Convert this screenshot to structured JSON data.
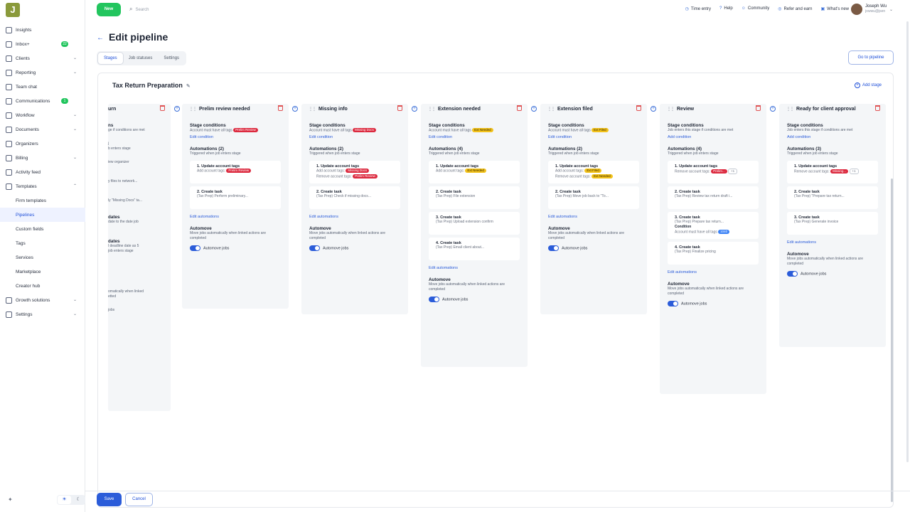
{
  "sidebar": {
    "logo": "J",
    "items": [
      {
        "label": "Insights"
      },
      {
        "label": "Inbox+",
        "badge": "22"
      },
      {
        "label": "Clients",
        "chev": "⌄"
      },
      {
        "label": "Reporting",
        "chev": "⌄"
      },
      {
        "label": "Team chat"
      },
      {
        "label": "Communications",
        "badge": "1"
      },
      {
        "label": "Workflow",
        "chev": "⌄"
      },
      {
        "label": "Documents",
        "chev": "⌄"
      },
      {
        "label": "Organizers"
      },
      {
        "label": "Billing",
        "chev": "⌄"
      },
      {
        "label": "Activity feed"
      },
      {
        "label": "Templates",
        "chev": "⌃"
      },
      {
        "label": "Firm templates"
      },
      {
        "label": "Pipelines"
      },
      {
        "label": "Custom fields"
      },
      {
        "label": "Tags"
      },
      {
        "label": "Services"
      },
      {
        "label": "Marketplace"
      },
      {
        "label": "Creator hub"
      },
      {
        "label": "Growth solutions",
        "chev": "⌄"
      },
      {
        "label": "Settings",
        "chev": "⌄"
      }
    ]
  },
  "topbar": {
    "new_label": "New",
    "search_placeholder": "Search",
    "links": [
      "Time entry",
      "Help",
      "Community",
      "Refer and earn",
      "What's new"
    ],
    "user_name": "Joseph Wu",
    "user_email": "jowwu@jsen"
  },
  "page": {
    "title": "Edit pipeline",
    "tabs": [
      "Stages",
      "Job statuses",
      "Settings"
    ],
    "goto_label": "Go to pipeline",
    "pipeline_name": "Tax Return Preparation",
    "add_stage": "Add stage"
  },
  "first_stage": {
    "name": "urn",
    "lines": [
      "ns",
      "ge if conditions are met",
      "j",
      "b enters stage",
      "iew organizer",
      "y files to network...",
      "ly \"Missing Docs\" ta...",
      "dates",
      "date to the date job",
      "dates",
      "l deadline date as 5",
      "job enters stage",
      "omatically when linked",
      "etted",
      "jobs"
    ]
  },
  "stages": [
    {
      "name": "Prelim review needed",
      "cond_heading": "Stage conditions",
      "cond_text": "Account must have all tags",
      "cond_tag": "Prelim Review",
      "cond_tag_color": "#dc2a3f",
      "edit_condition": "Edit condition",
      "auto_heading": "Automations (2)",
      "auto_sub": "Triggered when job enters stage",
      "autos": [
        {
          "title": "1. Update account tags",
          "lines": [
            {
              "text": "Add account tags:",
              "tag": "Prelim Review",
              "tagc": "r"
            }
          ]
        },
        {
          "title": "2. Create task",
          "lines": [
            {
              "text": "(Tax Prep) Perform preliminary..."
            }
          ]
        }
      ],
      "edit_automations": "Edit automations",
      "automove_heading": "Automove",
      "automove_text": "Move jobs automatically when linked actions are completed",
      "automove_toggle": "Automove jobs"
    },
    {
      "name": "Missing info",
      "cond_heading": "Stage conditions",
      "cond_text": "Account must have all tags",
      "cond_tag": "Missing Docs",
      "cond_tag_color": "#dc2a3f",
      "edit_condition": "Edit condition",
      "auto_heading": "Automations (2)",
      "auto_sub": "Triggered when job enters stage",
      "autos": [
        {
          "title": "1. Update account tags",
          "lines": [
            {
              "text": "Add account tags:",
              "tag": "Missing Docs",
              "tagc": "r"
            },
            {
              "text": "Remove account tags:",
              "tag": "Prelim Review",
              "tagc": "r"
            }
          ]
        },
        {
          "title": "2. Create task",
          "lines": [
            {
              "text": "(Tax Prep) Check if missing docs..."
            }
          ]
        }
      ],
      "edit_automations": "Edit automations",
      "automove_heading": "Automove",
      "automove_text": "Move jobs automatically when linked actions are completed",
      "automove_toggle": "Automove jobs"
    },
    {
      "name": "Extension needed",
      "cond_heading": "Stage conditions",
      "cond_text": "Account must have all tags",
      "cond_tag": "Ext Needed",
      "cond_tag_color": "#f2c21b",
      "edit_condition": "Edit condition",
      "auto_heading": "Automations (4)",
      "auto_sub": "Triggered when job enters stage",
      "autos": [
        {
          "title": "1. Update account tags",
          "lines": [
            {
              "text": "Add account tags:",
              "tag": "Ext Needed",
              "tagc": "y"
            }
          ]
        },
        {
          "title": "2. Create task",
          "lines": [
            {
              "text": "(Tax Prep) File extension"
            }
          ]
        },
        {
          "title": "3. Create task",
          "lines": [
            {
              "text": "(Tax Prep) Upload extension confirm"
            }
          ]
        },
        {
          "title": "4. Create task",
          "lines": [
            {
              "text": "(Tax Prep) Email client about..."
            }
          ]
        }
      ],
      "edit_automations": "Edit automations",
      "automove_heading": "Automove",
      "automove_text": "Move jobs automatically when linked actions are completed",
      "automove_toggle": "Automove jobs"
    },
    {
      "name": "Extension filed",
      "cond_heading": "Stage conditions",
      "cond_text": "Account must have all tags",
      "cond_tag": "Ext Filed",
      "cond_tag_color": "#f2c21b",
      "edit_condition": "Edit condition",
      "auto_heading": "Automations (2)",
      "auto_sub": "Triggered when job enters stage",
      "autos": [
        {
          "title": "1. Update account tags",
          "lines": [
            {
              "text": "Add account tags:",
              "tag": "Ext Filed",
              "tagc": "y"
            },
            {
              "text": "Remove account tags:",
              "tag": "Ext Needed",
              "tagc": "y"
            }
          ]
        },
        {
          "title": "2. Create task",
          "lines": [
            {
              "text": "(Tax Prep) Move job back to \"To..."
            }
          ]
        }
      ],
      "edit_automations": "Edit automations",
      "automove_heading": "Automove",
      "automove_text": "Move jobs automatically when linked actions are completed",
      "automove_toggle": "Automove jobs"
    },
    {
      "name": "Review",
      "cond_heading": "Stage conditions",
      "cond_text": "Job enters this stage if conditions are met",
      "cond_tag": "",
      "cond_tag_color": "",
      "edit_condition": "Add condition",
      "auto_heading": "Automations (4)",
      "auto_sub": "Triggered when job enters stage",
      "autos": [
        {
          "title": "1. Update account tags",
          "lines": [
            {
              "text": "Remove account tags:",
              "tag": "Prelim...",
              "tagc": "r",
              "extra": "+1"
            }
          ]
        },
        {
          "title": "2. Create task",
          "lines": [
            {
              "text": "(Tax Prep) Review tax return draft i..."
            }
          ]
        },
        {
          "title": "3. Create task",
          "lines": [
            {
              "text": "(Tax Prep) Prepare tax return..."
            },
            {
              "text": "Condition",
              "bold": true
            },
            {
              "text": "Account must have all tags",
              "tag": "1040",
              "tagc": "b"
            }
          ]
        },
        {
          "title": "4. Create task",
          "lines": [
            {
              "text": "(Tax Prep) Finalize pricing"
            }
          ]
        }
      ],
      "edit_automations": "Edit automations",
      "automove_heading": "Automove",
      "automove_text": "Move jobs automatically when linked actions are completed",
      "automove_toggle": "Automove jobs"
    },
    {
      "name": "Ready for client approval",
      "cond_heading": "Stage conditions",
      "cond_text": "Job enters this stage if conditions are met",
      "cond_tag": "",
      "cond_tag_color": "",
      "edit_condition": "Add condition",
      "auto_heading": "Automations (3)",
      "auto_sub": "Triggered when job enters stage",
      "autos": [
        {
          "title": "1. Update account tags",
          "lines": [
            {
              "text": "Remove account tags:",
              "tag": "Missing...",
              "tagc": "r",
              "extra": "+1"
            }
          ]
        },
        {
          "title": "2. Create task",
          "lines": [
            {
              "text": "(Tax Prep) \"Prepare tax return..."
            }
          ]
        },
        {
          "title": "3. Create task",
          "lines": [
            {
              "text": "(Tax Prep) Generate invoice"
            }
          ]
        }
      ],
      "edit_automations": "Edit automations",
      "automove_heading": "Automove",
      "automove_text": "Move jobs automatically when linked actions are completed",
      "automove_toggle": "Automove jobs"
    }
  ],
  "footer": {
    "save": "Save",
    "cancel": "Cancel"
  }
}
